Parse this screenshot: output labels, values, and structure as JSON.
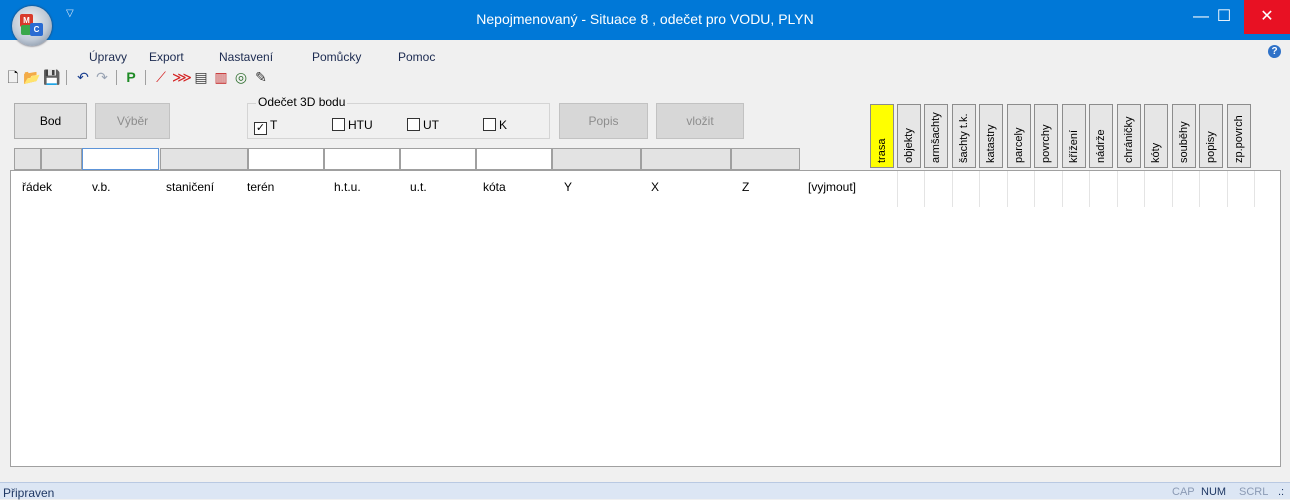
{
  "window": {
    "title": "Nepojmenovaný - Situace 8 , odečet pro VODU, PLYN",
    "minimize_glyph": "—",
    "maximize_glyph": "☐",
    "close_glyph": "✕",
    "qat_glyph": "▽",
    "orb_letters": {
      "m": "M",
      "c": "C"
    }
  },
  "menu": {
    "items": [
      "Úpravy",
      "Export",
      "Nastavení",
      "Pomůcky",
      "Pomoc"
    ],
    "help_glyph": "?"
  },
  "toolbar": {
    "icons": [
      "new-icon",
      "open-icon",
      "save-icon",
      "undo-icon",
      "redo-icon",
      "p-icon",
      "route-icon",
      "profile-icon",
      "report-icon",
      "report-red-icon",
      "view-icon",
      "eraser-icon"
    ],
    "glyphs": [
      "🗋",
      "📂",
      "💾",
      "↶",
      "↷",
      "P",
      "⟋",
      "⋙",
      "▤",
      "▥",
      "◎",
      "✎"
    ]
  },
  "buttons": {
    "bod": "Bod",
    "vyber": "Výběr",
    "popis": "Popis",
    "vlozit": "vložit"
  },
  "odecet": {
    "label": "Odečet 3D bodu",
    "options": [
      {
        "label": "T",
        "checked": true
      },
      {
        "label": "HTU",
        "checked": false
      },
      {
        "label": "UT",
        "checked": false
      },
      {
        "label": "K",
        "checked": false
      }
    ],
    "check_glyph": "✓"
  },
  "table": {
    "columns": [
      "řádek",
      "v.b.",
      "staničení",
      "terén",
      "h.t.u.",
      "u.t.",
      "kóta",
      "Y",
      "X",
      "Z",
      "[vyjmout]"
    ]
  },
  "tabs": [
    {
      "label": "trasa",
      "active": true
    },
    {
      "label": "objekty",
      "active": false
    },
    {
      "label": "armšachty",
      "active": false
    },
    {
      "label": "šachty t.k.",
      "active": false
    },
    {
      "label": "katastry",
      "active": false
    },
    {
      "label": "parcely",
      "active": false
    },
    {
      "label": "povrchy",
      "active": false
    },
    {
      "label": "křížení",
      "active": false
    },
    {
      "label": "nádrže",
      "active": false
    },
    {
      "label": "chráničky",
      "active": false
    },
    {
      "label": "kóty",
      "active": false
    },
    {
      "label": "souběhy",
      "active": false
    },
    {
      "label": "popisy",
      "active": false
    },
    {
      "label": "zp.povrch",
      "active": false
    }
  ],
  "status": {
    "text": "Připraven",
    "indicators": [
      {
        "label": "CAP",
        "on": false
      },
      {
        "label": "NUM",
        "on": true
      },
      {
        "label": "SCRL",
        "on": false
      }
    ],
    "grip_glyph": ".:"
  },
  "colors": {
    "titlebar": "#0078d7",
    "close": "#e81123",
    "active_tab": "#ffff00",
    "statusbar": "#dce6f4"
  }
}
